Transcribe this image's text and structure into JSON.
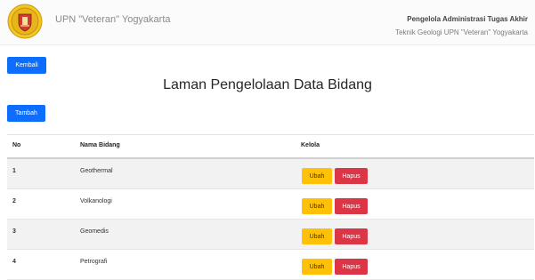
{
  "header": {
    "brand": "UPN \"Veteran\" Yogyakarta",
    "app_title": "Pengelola Administrasi Tugas Akhir",
    "app_subtitle": "Teknik Geologi UPN \"Veteran\" Yogyakarta",
    "logo_icon": "university-seal-icon"
  },
  "actions": {
    "back_label": "Kembali",
    "add_label": "Tambah"
  },
  "page_title": "Laman Pengelolaan Data Bidang",
  "table": {
    "columns": [
      "No",
      "Nama Bidang",
      "Kelola"
    ],
    "rows": [
      {
        "no": "1",
        "nama": "Geothermal",
        "edit": "Ubah",
        "delete": "Hapus"
      },
      {
        "no": "2",
        "nama": "Volkanologi",
        "edit": "Ubah",
        "delete": "Hapus"
      },
      {
        "no": "3",
        "nama": "Geomedis",
        "edit": "Ubah",
        "delete": "Hapus"
      },
      {
        "no": "4",
        "nama": "Petrografi",
        "edit": "Ubah",
        "delete": "Hapus"
      }
    ]
  },
  "colors": {
    "primary": "#0d6efd",
    "warning": "#ffc107",
    "danger": "#dc3545"
  }
}
